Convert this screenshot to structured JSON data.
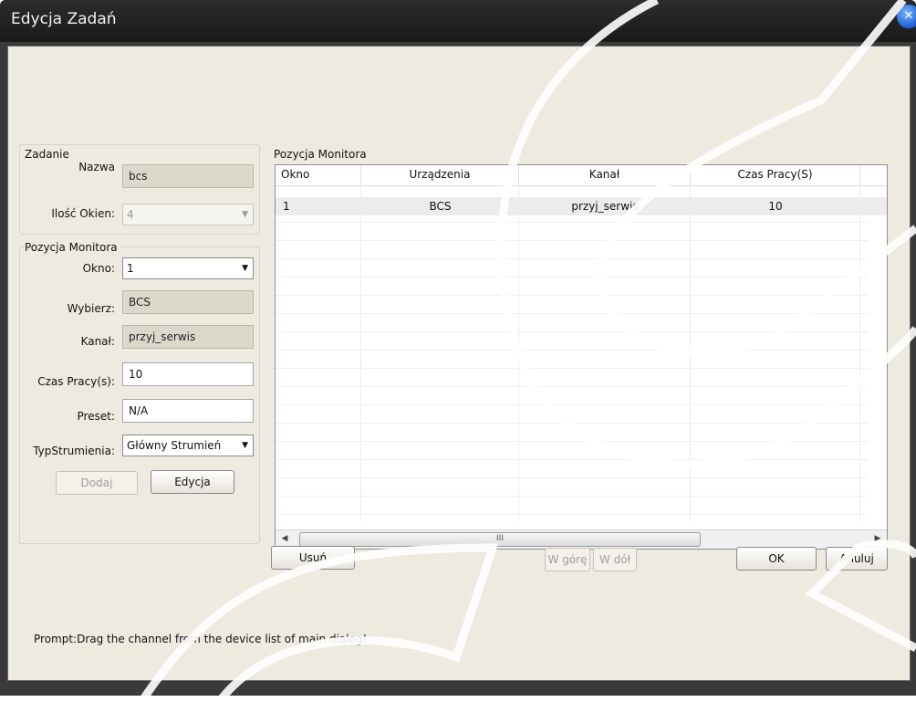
{
  "window": {
    "title": "Edycja Zadań",
    "close_glyph": "✕"
  },
  "task_group": {
    "title": "Zadanie",
    "name_label": "Nazwa",
    "name_value": "bcs",
    "windows_label": "Ilość Okien:",
    "windows_value": "4"
  },
  "monitor_group": {
    "title": "Pozycja Monitora",
    "window_label": "Okno:",
    "window_value": "1",
    "select_label": "Wybierz:",
    "select_value": "BCS",
    "channel_label": "Kanał:",
    "channel_value": "przyj_serwis",
    "worktime_label": "Czas Pracy(s):",
    "worktime_value": "10",
    "preset_label": "Preset:",
    "preset_value": "N/A",
    "stream_label": "TypStrumienia:",
    "stream_value": "Główny Strumień",
    "add_label": "Dodaj",
    "edit_label": "Edycja"
  },
  "list_panel": {
    "title": "Pozycja Monitora",
    "columns": [
      "Okno",
      "Urządzenia",
      "Kanał",
      "Czas Pracy(S)"
    ],
    "rows": [
      [
        "1",
        "BCS",
        "przyj_serwis",
        "10"
      ]
    ],
    "scroll_thumb_glyph": "III"
  },
  "buttons": {
    "delete": "Usuń",
    "up": "W górę",
    "down": "W dół",
    "ok": "OK",
    "cancel": "Anuluj"
  },
  "prompt": "Prompt:Drag the channel from the device list of main dialog!",
  "icons": {
    "combo_arrow": "chevron-down-icon",
    "close": "close-icon",
    "scroll_left": "arrow-left-icon",
    "scroll_right": "arrow-right-icon"
  }
}
